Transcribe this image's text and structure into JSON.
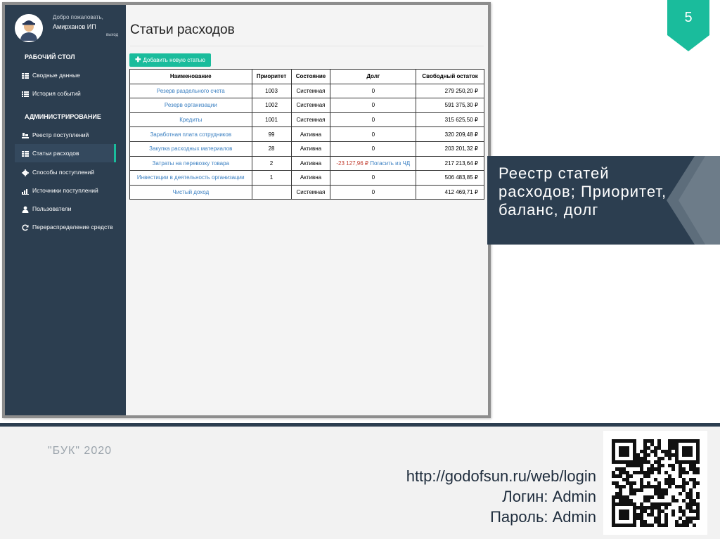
{
  "sidebar": {
    "welcome": "Добро пожаловать,",
    "user_name": "Амирханов ИП",
    "logout": "выход",
    "sections": [
      {
        "title": "РАБОЧИЙ СТОЛ"
      },
      {
        "title": "АДМИНИСТРИРОВАНИЕ"
      }
    ],
    "desk_items": [
      {
        "label": "Сводные данные",
        "icon": "table-icon"
      },
      {
        "label": "История событий",
        "icon": "list-icon"
      }
    ],
    "admin_items": [
      {
        "label": "Реестр поступлений",
        "icon": "register-icon"
      },
      {
        "label": "Статьи расходов",
        "icon": "table-icon",
        "active": true
      },
      {
        "label": "Способы поступлений",
        "icon": "gear-icon"
      },
      {
        "label": "Источники поступлений",
        "icon": "bar-chart-icon"
      },
      {
        "label": "Пользователи",
        "icon": "user-icon"
      },
      {
        "label": "Перераспределение средств",
        "icon": "refresh-icon"
      }
    ]
  },
  "main": {
    "title": "Статьи расходов",
    "add_button": "Добавить новую статью",
    "columns": [
      "Наименование",
      "Приоритет",
      "Состояние",
      "Долг",
      "Свободный остаток"
    ],
    "rows": [
      {
        "name": "Резерв раздельного счета",
        "priority": "1003",
        "state": "Системная",
        "debt": "0",
        "balance": "279 250,20 ₽"
      },
      {
        "name": "Резерв организации",
        "priority": "1002",
        "state": "Системная",
        "debt": "0",
        "balance": "591 375,30 ₽"
      },
      {
        "name": "Кредиты",
        "priority": "1001",
        "state": "Системная",
        "debt": "0",
        "balance": "315 625,50 ₽"
      },
      {
        "name": "Заработная плата сотрудников",
        "priority": "99",
        "state": "Активна",
        "debt": "0",
        "balance": "320 209,48 ₽"
      },
      {
        "name": "Закупка расходных материалов",
        "priority": "28",
        "state": "Активна",
        "debt": "0",
        "balance": "203 201,32 ₽"
      },
      {
        "name": "Затраты на перевозку товара",
        "priority": "2",
        "state": "Активна",
        "debt": "-23 127,96 ₽",
        "debt_action": "Погасить из ЧД",
        "balance": "217 213,64 ₽"
      },
      {
        "name": "Инвестиции в деятельность организации",
        "priority": "1",
        "state": "Активна",
        "debt": "0",
        "balance": "506 483,85 ₽"
      },
      {
        "name": "Чистый доход",
        "priority": "",
        "state": "Системная",
        "debt": "0",
        "balance": "412 469,71 ₽"
      }
    ]
  },
  "slide": {
    "number": "5",
    "callout": "Реестр статей расходов; Приоритет, баланс, долг",
    "year": "\"БУК\" 2020",
    "url": "http://godofsun.ru/web/login",
    "login": "Логин: Admin",
    "password": "Пароль: Admin"
  },
  "colors": {
    "sidebar_bg": "#2c3e50",
    "accent": "#1abc9c",
    "link": "#3a7fc1",
    "negative": "#c0392b",
    "callout_bg": "#2c3e50"
  }
}
